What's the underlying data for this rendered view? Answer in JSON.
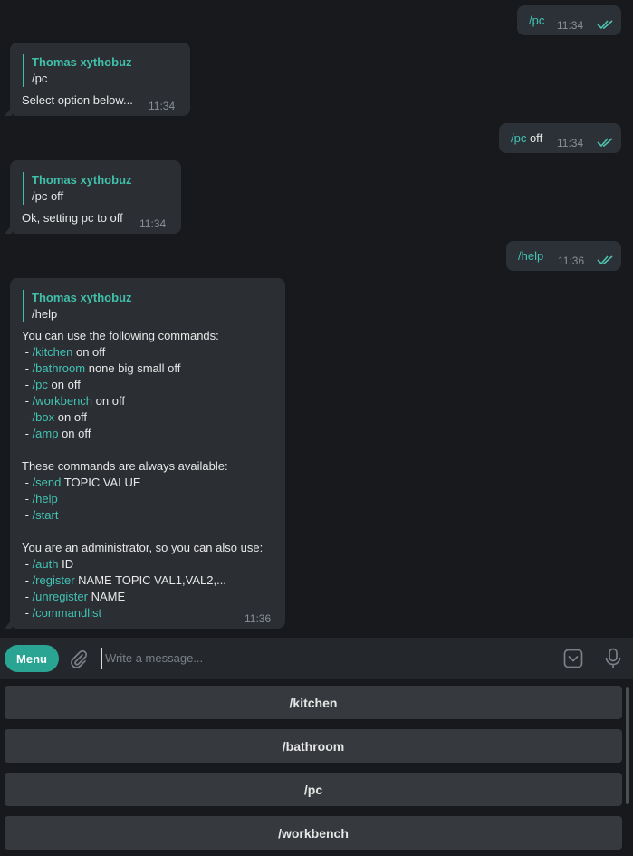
{
  "messages": {
    "m1": {
      "cmd": "/pc",
      "time": "11:34"
    },
    "m2": {
      "reply_name": "Thomas xythobuz",
      "reply_text": "/pc",
      "text": "Select option below...",
      "time": "11:34"
    },
    "m3": {
      "cmd": "/pc",
      "rest": " off",
      "time": "11:34"
    },
    "m4": {
      "reply_name": "Thomas xythobuz",
      "reply_text": "/pc off",
      "text": "Ok, setting pc to off",
      "time": "11:34"
    },
    "m5": {
      "cmd": "/help",
      "time": "11:36"
    },
    "m6": {
      "reply_name": "Thomas xythobuz",
      "reply_text": "/help",
      "intro": "You can use the following commands:",
      "commands": [
        {
          "prefix": " - ",
          "cmd": "/kitchen",
          "args": " on off"
        },
        {
          "prefix": " - ",
          "cmd": "/bathroom",
          "args": " none big small off"
        },
        {
          "prefix": " - ",
          "cmd": "/pc",
          "args": " on off"
        },
        {
          "prefix": " - ",
          "cmd": "/workbench",
          "args": " on off"
        },
        {
          "prefix": " - ",
          "cmd": "/box",
          "args": " on off"
        },
        {
          "prefix": " - ",
          "cmd": "/amp",
          "args": " on off"
        }
      ],
      "always_heading": "These commands are always available:",
      "always": [
        {
          "prefix": " - ",
          "cmd": "/send",
          "args": " TOPIC VALUE"
        },
        {
          "prefix": " - ",
          "cmd": "/help",
          "args": ""
        },
        {
          "prefix": " - ",
          "cmd": "/start",
          "args": ""
        }
      ],
      "admin_heading": "You are an administrator, so you can also use:",
      "admin": [
        {
          "prefix": " - ",
          "cmd": "/auth",
          "args": " ID"
        },
        {
          "prefix": " - ",
          "cmd": "/register",
          "args": " NAME TOPIC VAL1,VAL2,..."
        },
        {
          "prefix": " - ",
          "cmd": "/unregister",
          "args": " NAME"
        },
        {
          "prefix": " - ",
          "cmd": "/commandlist",
          "args": ""
        }
      ],
      "time": "11:36"
    }
  },
  "composer": {
    "menu_label": "Menu",
    "placeholder": "Write a message...",
    "icons": [
      "paperclip-icon",
      "bot-keyboard-icon",
      "microphone-icon"
    ]
  },
  "keyboard": {
    "buttons": [
      "/kitchen",
      "/bathroom",
      "/pc",
      "/workbench"
    ]
  },
  "colors": {
    "accent": "#2aa594",
    "command_link": "#42c3b4",
    "read_ticks": "#4fc3b0",
    "background": "#17191c"
  }
}
